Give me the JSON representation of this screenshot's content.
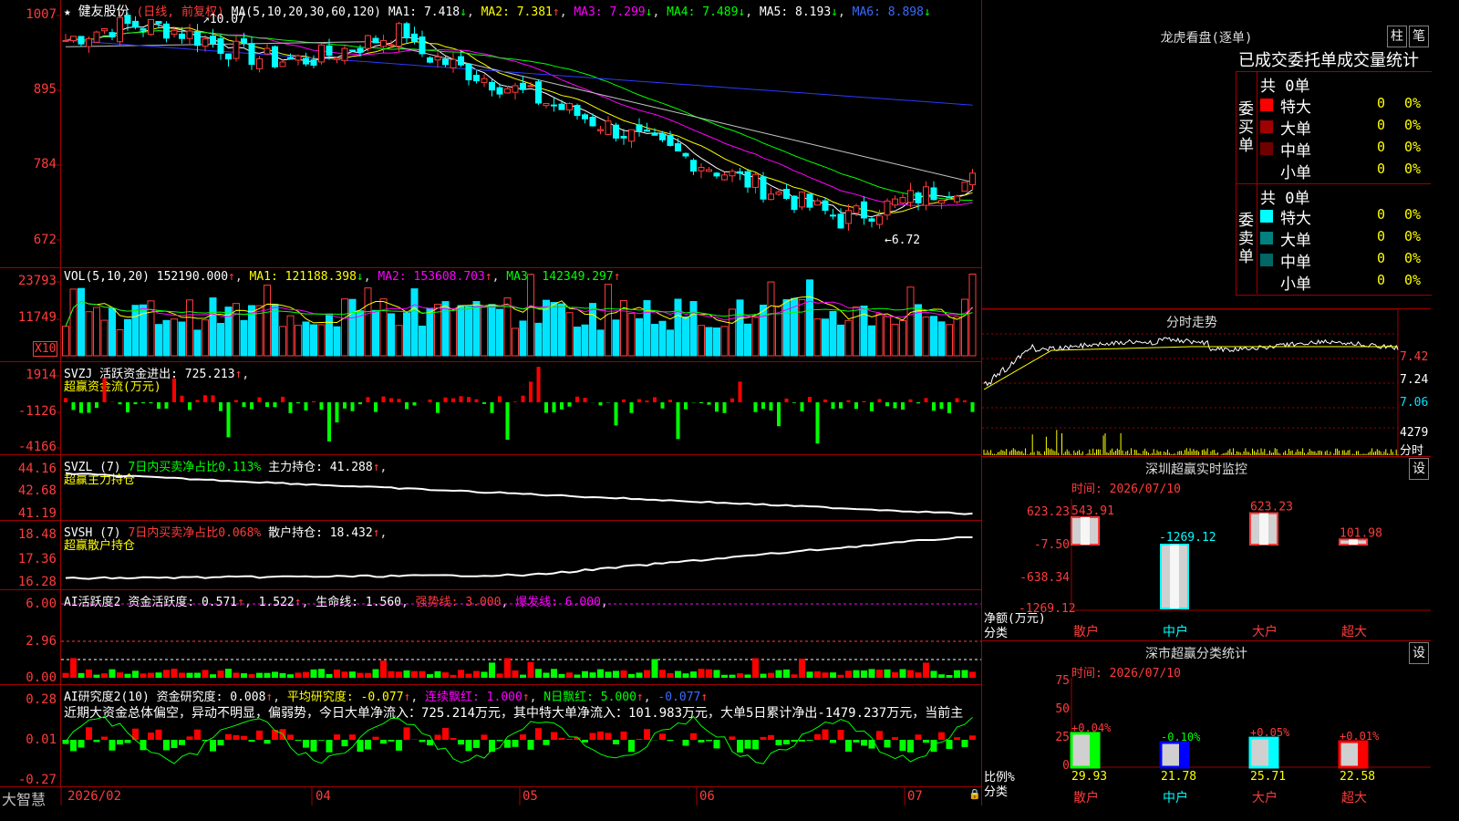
{
  "kline": {
    "star": "★",
    "stock": "健友股份",
    "period": "(日线, 前复权)",
    "ma_label": "MA(5,10,20,30,60,120)",
    "ma1": "MA1: 7.418",
    "ma2": "MA2: 7.381",
    "ma3": "MA3: 7.299",
    "ma4": "MA4: 7.489",
    "ma5": "MA5: 8.193",
    "ma6": "MA6: 8.898",
    "high_note": "10.07",
    "low_note": "←6.72",
    "y_ticks": [
      "1007",
      "895",
      "784",
      "672"
    ]
  },
  "vol": {
    "label": "VOL(5,10,20)",
    "value": "152190.000",
    "ma1": "MA1: 121188.398",
    "ma2": "MA2: 153608.703",
    "ma3": "MA3: 142349.297",
    "y_ticks": [
      "23793",
      "11749"
    ],
    "unit": "X10"
  },
  "svzj": {
    "label": "SVZJ",
    "text": "活跃资金进出: 725.213",
    "sub": "超赢资金流(万元)",
    "y_ticks": [
      "1914",
      "-1126",
      "-4166"
    ]
  },
  "svzl": {
    "label": "SVZL (7)",
    "pct": "7日内买卖净占比0.113%",
    "hold": "主力持仓: 41.288",
    "sub": "超赢主力持仓",
    "y_ticks": [
      "44.16",
      "42.68",
      "41.19"
    ]
  },
  "svsh": {
    "label": "SVSH (7)",
    "pct": "7日内买卖净占比0.068%",
    "hold": "散户持仓: 18.432",
    "sub": "超赢散户持仓",
    "y_ticks": [
      "18.48",
      "17.36",
      "16.28"
    ]
  },
  "ai1": {
    "label": "AI活跃度2",
    "a": "资金活跃度: 0.571",
    "b": "1.522",
    "c": "生命线: 1.560",
    "d": "强势线: 3.000",
    "e": "爆发线: 6.000",
    "y_ticks": [
      "6.00",
      "2.96",
      "0.00"
    ]
  },
  "ai2": {
    "label": "AI研究度2(10)",
    "a": "资金研究度: 0.008",
    "b": "平均研究度: -0.077",
    "c": "连续飘红: 1.000",
    "d": "N日飘红: 5.000",
    "e": "-0.077",
    "summary": "近期大资金总体偏空，异动不明显，偏弱势，今日大单净流入：725.214万元，其中特大单净流入：101.983万元，大单5日累计净出-1479.237万元，当前主",
    "y_ticks": [
      "0.28",
      "0.01",
      "-0.27"
    ]
  },
  "xaxis": {
    "brand": "大智慧",
    "labels": [
      "2026/02",
      "04",
      "05",
      "06",
      "07"
    ]
  },
  "lhb": {
    "title": "龙虎看盘(逐单)",
    "btn1": "柱",
    "btn2": "笔",
    "subtitle": "已成交委托单成交量统计",
    "buy_side": "委买单",
    "sell_side": "委卖单",
    "buy_total": "共 0单",
    "sell_total": "共 0单",
    "buy_rows": [
      {
        "name": "特大",
        "n": "0",
        "p": "0%",
        "color": "#ff0000"
      },
      {
        "name": "大单",
        "n": "0",
        "p": "0%",
        "color": "#a00000"
      },
      {
        "name": "中单",
        "n": "0",
        "p": "0%",
        "color": "#700000"
      },
      {
        "name": "小单",
        "n": "0",
        "p": "0%",
        "color": "#000000"
      }
    ],
    "sell_rows": [
      {
        "name": "特大",
        "n": "0",
        "p": "0%",
        "color": "#00ffff"
      },
      {
        "name": "大单",
        "n": "0",
        "p": "0%",
        "color": "#008080"
      },
      {
        "name": "中单",
        "n": "0",
        "p": "0%",
        "color": "#006666"
      },
      {
        "name": "小单",
        "n": "0",
        "p": "0%",
        "color": "#000000"
      }
    ]
  },
  "fenshi": {
    "title": "分时走势",
    "y_ticks": [
      "7.42",
      "7.24",
      "7.06",
      "4279"
    ],
    "vol_label": "分时"
  },
  "monitor": {
    "title": "深圳超赢实时监控",
    "btn": "设",
    "time": "时间: 2026/07/10",
    "y_ticks": [
      "623.23",
      "-7.50",
      "-638.34",
      "-1269.12"
    ],
    "side_label1": "净额(万元)",
    "side_label2": "分类",
    "bars": [
      {
        "name": "散户",
        "value": "543.91",
        "v": 543.91
      },
      {
        "name": "中户",
        "value": "-1269.12",
        "v": -1269.12
      },
      {
        "name": "大户",
        "value": "623.23",
        "v": 623.23
      },
      {
        "name": "超大",
        "value": "101.98",
        "v": 101.98
      }
    ]
  },
  "classify": {
    "title": "深市超赢分类统计",
    "btn": "设",
    "time": "时间: 2026/07/10",
    "y_ticks": [
      "75",
      "50",
      "25",
      "0"
    ],
    "side_label1": "比例%",
    "side_label2": "分类",
    "bars": [
      {
        "name": "散户",
        "value": "29.93",
        "change": "+0.04%",
        "v": 29.93,
        "color": "#00ff00"
      },
      {
        "name": "中户",
        "value": "21.78",
        "change": "-0.10%",
        "v": 21.78,
        "color": "#0000ff"
      },
      {
        "name": "大户",
        "value": "25.71",
        "change": "+0.05%",
        "v": 25.71,
        "color": "#00ffff"
      },
      {
        "name": "超大",
        "value": "22.58",
        "change": "+0.01%",
        "v": 22.58,
        "color": "#ff0000"
      }
    ]
  }
}
